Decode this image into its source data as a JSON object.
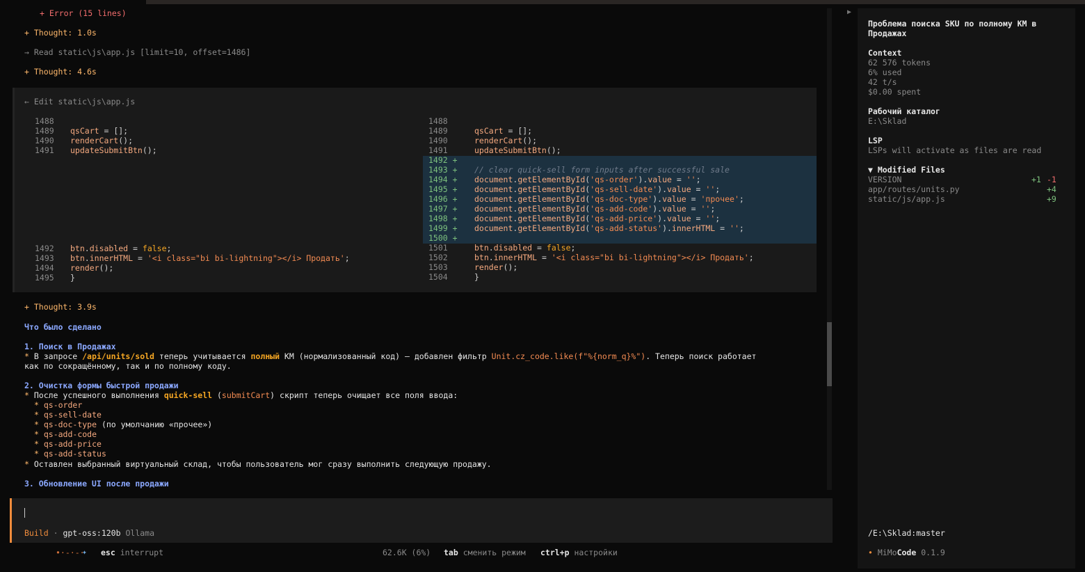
{
  "log": {
    "error_line": "+ Error (15 lines)",
    "thought1": "+ Thought: 1.0s",
    "read_line": "→ Read static\\js\\app.js [limit=10, offset=1486]",
    "thought2": "+ Thought: 4.6s",
    "thought3": "+ Thought: 3.9s"
  },
  "diff": {
    "header": "← Edit static\\js\\app.js",
    "left": [
      {
        "n": "1488",
        "code": ""
      },
      {
        "n": "1489",
        "code": "qsCart = [];"
      },
      {
        "n": "1490",
        "code": "renderCart();"
      },
      {
        "n": "1491",
        "code": "updateSubmitBtn();"
      },
      {
        "n": "1492",
        "code": "btn.disabled = false;"
      },
      {
        "n": "1493",
        "code": "btn.innerHTML = '<i class=\"bi bi-lightning\"></i> Продать';"
      },
      {
        "n": "1494",
        "code": "render();"
      },
      {
        "n": "1495",
        "code": "}"
      }
    ],
    "right_context_top": [
      {
        "n": "1488",
        "code": ""
      },
      {
        "n": "1489",
        "code": "qsCart = [];"
      },
      {
        "n": "1490",
        "code": "renderCart();"
      },
      {
        "n": "1491",
        "code": "updateSubmitBtn();"
      }
    ],
    "right_added": [
      {
        "n": "1492 +",
        "code": ""
      },
      {
        "n": "1493 +",
        "code": "// clear quick-sell form inputs after successful sale"
      },
      {
        "n": "1494 +",
        "code": "document.getElementById('qs-order').value = '';"
      },
      {
        "n": "1495 +",
        "code": "document.getElementById('qs-sell-date').value = '';"
      },
      {
        "n": "1496 +",
        "code": "document.getElementById('qs-doc-type').value = 'прочее';"
      },
      {
        "n": "1497 +",
        "code": "document.getElementById('qs-add-code').value = '';"
      },
      {
        "n": "1498 +",
        "code": "document.getElementById('qs-add-price').value = '';"
      },
      {
        "n": "1499 +",
        "code": "document.getElementById('qs-add-status').innerHTML = '';"
      },
      {
        "n": "1500 +",
        "code": ""
      }
    ],
    "right_context_bottom": [
      {
        "n": "1501",
        "code": "btn.disabled = false;"
      },
      {
        "n": "1502",
        "code": "btn.innerHTML = '<i class=\"bi bi-lightning\"></i> Продать';"
      },
      {
        "n": "1503",
        "code": "render();"
      },
      {
        "n": "1504",
        "code": "}"
      }
    ]
  },
  "summary": {
    "heading": "Что было сделано",
    "s1_title": "1. Поиск в Продажах",
    "s1_a": "* В запросе ",
    "s1_b": "/api/units/sold",
    "s1_c": " теперь учитывается ",
    "s1_d": "полный",
    "s1_e": " КМ (нормализованный код) – добавлен фильтр ",
    "s1_f": "Unit.cz_code.like(f\"%{norm_q}%\")",
    "s1_g": ". Теперь поиск работает",
    "s1_h": "как по сокращённому, так и по полному коду.",
    "s2_title": "2. Очистка формы быстрой продажи",
    "s2_a": "* После успешного выполнения ",
    "s2_b": "quick-sell",
    "s2_c": " (",
    "s2_d": "submitCart",
    "s2_e": ") скрипт теперь очищает все поля ввода:",
    "s2_items": [
      "qs-order",
      "qs-sell-date",
      "qs-doc-type",
      "qs-add-code",
      "qs-add-price",
      "qs-add-status"
    ],
    "s2_doc_note": " (по умолчанию «прочее»)",
    "s2_last": " Оставлен выбранный виртуальный склад, чтобы пользователь мог сразу выполнить следующую продажу.",
    "s3_title": "3. Обновление UI после продажи"
  },
  "input": {
    "mode": "Build",
    "sep": "·",
    "model": "gpt-oss:120b",
    "provider": "Ollama"
  },
  "status": {
    "spinner": "•·-·-·",
    "esc_key": "esc",
    "esc_label": "interrupt",
    "tokens": "62.6K (6%)",
    "tab_key": "tab",
    "tab_label": "сменить режим",
    "ctrl_key": "ctrl+p",
    "ctrl_label": "настройки"
  },
  "sidebar": {
    "title1": "Проблема поиска SKU по полному КМ в",
    "title2": "Продажах",
    "context_label": "Context",
    "tokens": "62 576 tokens",
    "used": "6% used",
    "speed": "42 t/s",
    "spent": "$0.00 spent",
    "workdir_label": "Рабочий каталог",
    "workdir": "E:\\Sklad",
    "lsp_label": "LSP",
    "lsp_text": "LSPs will activate as files are read",
    "modified_label": "▼ Modified Files",
    "files": [
      {
        "name": "VERSION",
        "add": "+1",
        "del": "-1"
      },
      {
        "name": "app/routes/units.py",
        "add": "+4",
        "del": ""
      },
      {
        "name": "static/js/app.js",
        "add": "+9",
        "del": ""
      }
    ],
    "branch": "/E:\\Sklad:master",
    "brand_dot": "•",
    "brand_a": "MiMo",
    "brand_b": "Code",
    "version": "0.1.9"
  },
  "colors": {
    "accent": "#f08c3c",
    "added_bg": "#1c3140",
    "bg": "#0a0a0a"
  }
}
